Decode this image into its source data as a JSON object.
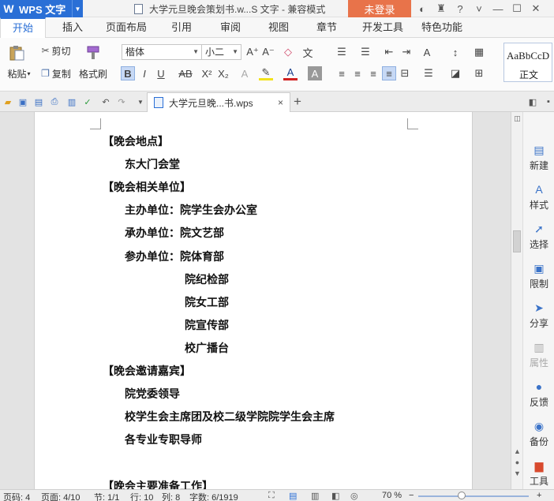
{
  "app": {
    "name": "WPS 文字",
    "window_title": "大学元旦晚会策划书.w...S 文字 - 兼容模式",
    "login_label": "未登录"
  },
  "ribbon_tabs": [
    "开始",
    "插入",
    "页面布局",
    "引用",
    "审阅",
    "视图",
    "章节",
    "开发工具",
    "特色功能"
  ],
  "ribbon": {
    "cut": "剪切",
    "copy": "复制",
    "paste": "粘贴",
    "format_painter": "格式刷",
    "font_name": "楷体",
    "font_size": "小二",
    "style_sample": "AaBbCcD",
    "style_name": "正文"
  },
  "doc_tab": {
    "name": "大学元旦晚...书.wps",
    "close": "×"
  },
  "document": {
    "lines": [
      "【晚会地点】",
      "东大门会堂",
      "【晚会相关单位】",
      "主办单位：院学生会办公室",
      "承办单位：院文艺部",
      "参办单位：院体育部",
      "院纪检部",
      "院女工部",
      "院宣传部",
      "校广播台",
      "【晚会邀请嘉宾】",
      "院党委领导",
      "校学生会主席团及校二级学院院学生会主席",
      "各专业专职导师",
      "【晚会主要准备工作】"
    ]
  },
  "right_pane": [
    "新建",
    "样式",
    "选择",
    "限制",
    "分享",
    "属性",
    "反馈",
    "备份",
    "工具"
  ],
  "status": {
    "page_no": "页码: 4",
    "pages": "页面: 4/10",
    "section": "节: 1/1",
    "row": "行: 10",
    "col": "列: 8",
    "words": "字数: 6/1919",
    "zoom": "70 %"
  }
}
